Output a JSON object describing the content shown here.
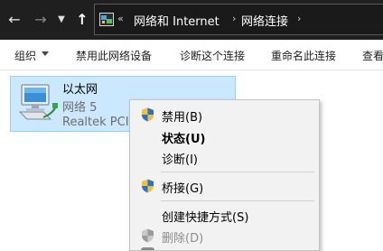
{
  "addressbar": {
    "overflow_marker": "«",
    "crumbs": [
      "网络和 Internet",
      "网络连接"
    ],
    "separator": "›"
  },
  "nav": {
    "back_icon": "arrow-left-icon",
    "forward_icon": "arrow-right-icon",
    "recent_icon": "chevron-down-icon",
    "up_icon": "arrow-up-icon"
  },
  "toolbar": {
    "organize": "组织",
    "disable_device": "禁用此网络设备",
    "diagnose": "诊断这个连接",
    "rename": "重命名此连接",
    "view_truncated": "查看"
  },
  "adapter": {
    "name": "以太网",
    "network": "网络 5",
    "device": "Realtek PCIe"
  },
  "context_menu": {
    "items": [
      {
        "label": "禁用(B)",
        "shield": true
      },
      {
        "label": "状态(U)",
        "bold": true
      },
      {
        "label": "诊断(I)"
      },
      {
        "label": "桥接(G)",
        "shield": true
      },
      {
        "label": "创建快捷方式(S)"
      },
      {
        "label": "删除(D)",
        "shield": true,
        "disabled": true
      }
    ]
  },
  "colors": {
    "address_bar_bg": "#1f1f1f",
    "selection_bg": "#cce8ff",
    "selection_border": "#99d1ff",
    "menu_bg": "#f2f2f2"
  }
}
